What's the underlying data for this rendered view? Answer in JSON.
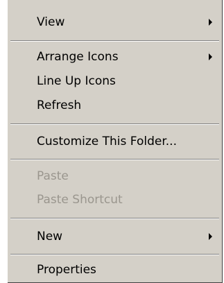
{
  "context_menu": {
    "items": [
      {
        "label": "View",
        "has_submenu": true,
        "enabled": true
      },
      {
        "label": "Arrange Icons",
        "has_submenu": true,
        "enabled": true
      },
      {
        "label": "Line Up Icons",
        "has_submenu": false,
        "enabled": true
      },
      {
        "label": "Refresh",
        "has_submenu": false,
        "enabled": true
      },
      {
        "label": "Customize This Folder...",
        "has_submenu": false,
        "enabled": true
      },
      {
        "label": "Paste",
        "has_submenu": false,
        "enabled": false
      },
      {
        "label": "Paste Shortcut",
        "has_submenu": false,
        "enabled": false
      },
      {
        "label": "New",
        "has_submenu": true,
        "enabled": true
      },
      {
        "label": "Properties",
        "has_submenu": false,
        "enabled": true
      }
    ]
  },
  "colors": {
    "menu_background": "#d4d0c8",
    "text": "#000000",
    "disabled_text": "#9a968e",
    "separator_dark": "#808080",
    "separator_light": "#ffffff"
  },
  "icons": {
    "submenu_arrow": "submenu-arrow-icon"
  }
}
